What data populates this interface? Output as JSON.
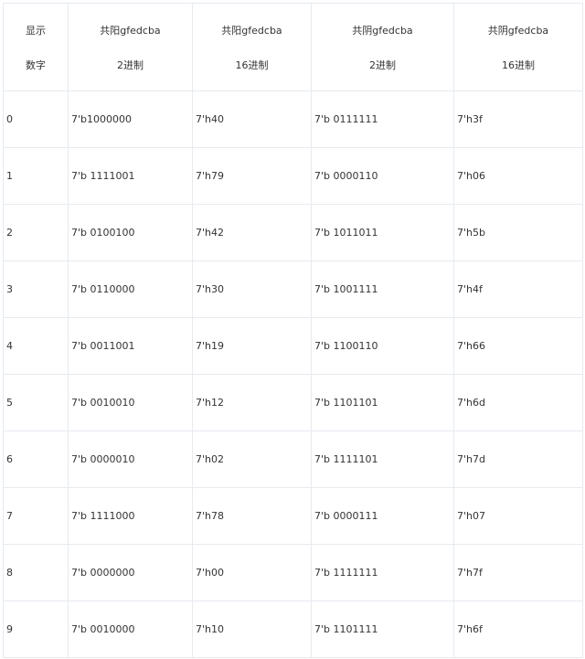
{
  "table": {
    "headers": [
      {
        "line1": "显示",
        "line2": "数字"
      },
      {
        "line1": "共阳gfedcba",
        "line2": "2进制"
      },
      {
        "line1": "共阳gfedcba",
        "line2": "16进制"
      },
      {
        "line1": "共阴gfedcba",
        "line2": "2进制"
      },
      {
        "line1": "共阴gfedcba",
        "line2": "16进制"
      }
    ],
    "rows": [
      [
        "0",
        "7'b1000000",
        "7'h40",
        "7'b 0111111",
        "7'h3f"
      ],
      [
        "1",
        "7'b 1111001",
        "7'h79",
        "7'b 0000110",
        "7'h06"
      ],
      [
        "2",
        "7'b 0100100",
        "7'h42",
        "7'b 1011011",
        "7'h5b"
      ],
      [
        "3",
        "7'b 0110000",
        "7'h30",
        "7'b 1001111",
        "7'h4f"
      ],
      [
        "4",
        "7'b 0011001",
        "7'h19",
        "7'b 1100110",
        "7'h66"
      ],
      [
        "5",
        "7'b 0010010",
        "7'h12",
        "7'b 1101101",
        "7'h6d"
      ],
      [
        "6",
        "7'b 0000010",
        "7'h02",
        "7'b 1111101",
        "7'h7d"
      ],
      [
        "7",
        "7'b 1111000",
        "7'h78",
        "7'b 0000111",
        "7'h07"
      ],
      [
        "8",
        "7'b 0000000",
        "7'h00",
        "7'b 1111111",
        "7'h7f"
      ],
      [
        "9",
        "7'b 0010000",
        "7'h10",
        "7'b 1101111",
        "7'h6f"
      ]
    ]
  },
  "colors": {
    "border": "#e6eaef",
    "text": "#333333",
    "background": "#ffffff"
  }
}
